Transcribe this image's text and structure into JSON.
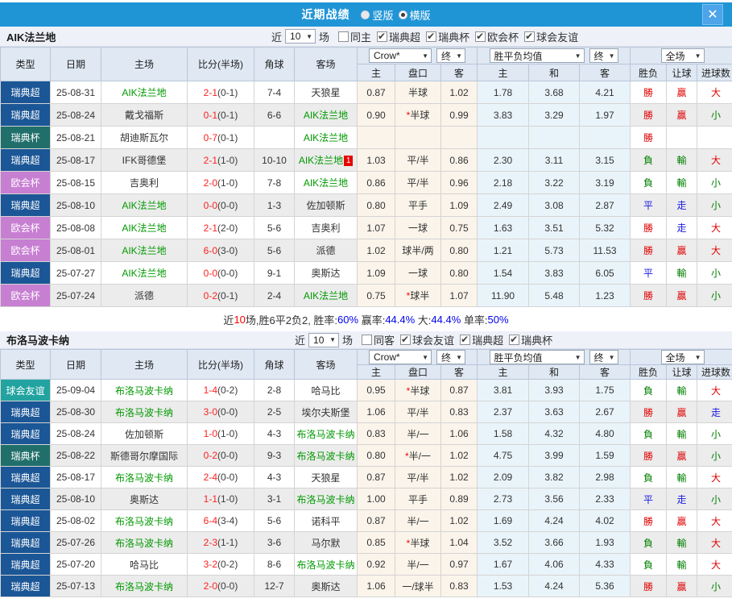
{
  "titlebar": {
    "title": "近期战绩",
    "radios": [
      {
        "label": "竖版",
        "checked": false
      },
      {
        "label": "横版",
        "checked": true
      }
    ],
    "close_icon": "✕"
  },
  "columns": {
    "main": [
      "类型",
      "日期",
      "主场",
      "比分(半场)",
      "角球",
      "客场"
    ],
    "sub": [
      "主",
      "盘口",
      "客",
      "主",
      "和",
      "客",
      "胜负",
      "让球",
      "进球数"
    ],
    "dropdowns": {
      "odds_company": "Crow*",
      "odds_stage": "终",
      "avg_label": "胜平负均值",
      "avg_stage": "终",
      "scope": "全场"
    }
  },
  "colors": {
    "titlebar_bg": "#2095d6",
    "type_badges": {
      "瑞典超": "#1b5696",
      "瑞典杯": "#206f6b",
      "欧会杯": "#c77fd2",
      "球会友谊": "#22a3a0"
    },
    "focus_team": "#009900",
    "score_fulltime": "#ff2020",
    "result_win": "#e00000",
    "result_lose": "#008000",
    "result_draw": "#1a1ae0",
    "summary_value_blue": "#0000ee",
    "summary_value_red": "#ff0000"
  },
  "result_color_map": {
    "勝": "win",
    "贏": "win",
    "大": "win",
    "負": "lose",
    "輸": "lose",
    "小": "lose",
    "平": "draw",
    "走": "draw"
  },
  "tables": [
    {
      "team": "AIK法兰地",
      "filter": {
        "near_label": "近",
        "games": "10",
        "games_suffix": "场",
        "checkboxes": [
          {
            "label": "同主",
            "checked": false
          },
          {
            "label": "瑞典超",
            "checked": true
          },
          {
            "label": "瑞典杯",
            "checked": true
          },
          {
            "label": "欧会杯",
            "checked": true
          },
          {
            "label": "球会友谊",
            "checked": true
          }
        ]
      },
      "rows": [
        {
          "type": "瑞典超",
          "date": "25-08-31",
          "home": "AIK法兰地",
          "hf": true,
          "score": "2-1",
          "half": "(0-1)",
          "corner": "7-4",
          "away": "天狼星",
          "af": false,
          "card": "",
          "star": false,
          "odds": [
            "0.87",
            "半球",
            "1.02"
          ],
          "avg": [
            "1.78",
            "3.68",
            "4.21"
          ],
          "res": [
            "勝",
            "贏",
            "大"
          ]
        },
        {
          "type": "瑞典超",
          "date": "25-08-24",
          "home": "戴戈福斯",
          "hf": false,
          "score": "0-1",
          "half": "(0-1)",
          "corner": "6-6",
          "away": "AIK法兰地",
          "af": true,
          "card": "",
          "star": true,
          "odds": [
            "0.90",
            "半球",
            "0.99"
          ],
          "avg": [
            "3.83",
            "3.29",
            "1.97"
          ],
          "res": [
            "勝",
            "贏",
            "小"
          ]
        },
        {
          "type": "瑞典杯",
          "date": "25-08-21",
          "home": "胡迪斯瓦尔",
          "hf": false,
          "score": "0-7",
          "half": "(0-1)",
          "corner": "",
          "away": "AIK法兰地",
          "af": true,
          "card": "",
          "star": false,
          "odds": [
            "",
            "",
            ""
          ],
          "avg": [
            "",
            "",
            ""
          ],
          "res": [
            "勝",
            "",
            ""
          ]
        },
        {
          "type": "瑞典超",
          "date": "25-08-17",
          "home": "IFK哥德堡",
          "hf": false,
          "score": "2-1",
          "half": "(1-0)",
          "corner": "10-10",
          "away": "AIK法兰地",
          "af": true,
          "card": "1",
          "star": false,
          "odds": [
            "1.03",
            "平/半",
            "0.86"
          ],
          "avg": [
            "2.30",
            "3.11",
            "3.15"
          ],
          "res": [
            "負",
            "輸",
            "大"
          ]
        },
        {
          "type": "欧会杯",
          "date": "25-08-15",
          "home": "吉奥利",
          "hf": false,
          "score": "2-0",
          "half": "(1-0)",
          "corner": "7-8",
          "away": "AIK法兰地",
          "af": true,
          "card": "",
          "star": false,
          "odds": [
            "0.86",
            "平/半",
            "0.96"
          ],
          "avg": [
            "2.18",
            "3.22",
            "3.19"
          ],
          "res": [
            "負",
            "輸",
            "小"
          ]
        },
        {
          "type": "瑞典超",
          "date": "25-08-10",
          "home": "AIK法兰地",
          "hf": true,
          "score": "0-0",
          "half": "(0-0)",
          "corner": "1-3",
          "away": "佐加顿斯",
          "af": false,
          "card": "",
          "star": false,
          "odds": [
            "0.80",
            "平手",
            "1.09"
          ],
          "avg": [
            "2.49",
            "3.08",
            "2.87"
          ],
          "res": [
            "平",
            "走",
            "小"
          ]
        },
        {
          "type": "欧会杯",
          "date": "25-08-08",
          "home": "AIK法兰地",
          "hf": true,
          "score": "2-1",
          "half": "(2-0)",
          "corner": "5-6",
          "away": "吉奥利",
          "af": false,
          "card": "",
          "star": false,
          "odds": [
            "1.07",
            "一球",
            "0.75"
          ],
          "avg": [
            "1.63",
            "3.51",
            "5.32"
          ],
          "res": [
            "勝",
            "走",
            "大"
          ]
        },
        {
          "type": "欧会杯",
          "date": "25-08-01",
          "home": "AIK法兰地",
          "hf": true,
          "score": "6-0",
          "half": "(3-0)",
          "corner": "5-6",
          "away": "派德",
          "af": false,
          "card": "",
          "star": false,
          "odds": [
            "1.02",
            "球半/两",
            "0.80"
          ],
          "avg": [
            "1.21",
            "5.73",
            "11.53"
          ],
          "res": [
            "勝",
            "贏",
            "大"
          ]
        },
        {
          "type": "瑞典超",
          "date": "25-07-27",
          "home": "AIK法兰地",
          "hf": true,
          "score": "0-0",
          "half": "(0-0)",
          "corner": "9-1",
          "away": "奥斯达",
          "af": false,
          "card": "",
          "star": false,
          "odds": [
            "1.09",
            "一球",
            "0.80"
          ],
          "avg": [
            "1.54",
            "3.83",
            "6.05"
          ],
          "res": [
            "平",
            "輸",
            "小"
          ]
        },
        {
          "type": "欧会杯",
          "date": "25-07-24",
          "home": "派德",
          "hf": false,
          "score": "0-2",
          "half": "(0-1)",
          "corner": "2-4",
          "away": "AIK法兰地",
          "af": true,
          "card": "",
          "star": true,
          "odds": [
            "0.75",
            "球半",
            "1.07"
          ],
          "avg": [
            "11.90",
            "5.48",
            "1.23"
          ],
          "res": [
            "勝",
            "贏",
            "小"
          ]
        }
      ],
      "summary": [
        {
          "text": "近",
          "color": "dark"
        },
        {
          "text": "10",
          "color": "red"
        },
        {
          "text": "场,胜6平2负2, 胜率:",
          "color": "dark"
        },
        {
          "text": "60%",
          "color": "blue"
        },
        {
          "text": " 赢率:",
          "color": "dark"
        },
        {
          "text": "44.4%",
          "color": "blue"
        },
        {
          "text": " 大:",
          "color": "dark"
        },
        {
          "text": "44.4%",
          "color": "blue"
        },
        {
          "text": " 单率:",
          "color": "dark"
        },
        {
          "text": "50%",
          "color": "blue"
        }
      ]
    },
    {
      "team": "布洛马波卡纳",
      "filter": {
        "near_label": "近",
        "games": "10",
        "games_suffix": "场",
        "checkboxes": [
          {
            "label": "同客",
            "checked": false
          },
          {
            "label": "球会友谊",
            "checked": true
          },
          {
            "label": "瑞典超",
            "checked": true
          },
          {
            "label": "瑞典杯",
            "checked": true
          }
        ]
      },
      "rows": [
        {
          "type": "球会友谊",
          "date": "25-09-04",
          "home": "布洛马波卡纳",
          "hf": true,
          "score": "1-4",
          "half": "(0-2)",
          "corner": "2-8",
          "away": "哈马比",
          "af": false,
          "card": "",
          "star": true,
          "odds": [
            "0.95",
            "半球",
            "0.87"
          ],
          "avg": [
            "3.81",
            "3.93",
            "1.75"
          ],
          "res": [
            "負",
            "輸",
            "大"
          ]
        },
        {
          "type": "瑞典超",
          "date": "25-08-30",
          "home": "布洛马波卡纳",
          "hf": true,
          "score": "3-0",
          "half": "(0-0)",
          "corner": "2-5",
          "away": "埃尔夫斯堡",
          "af": false,
          "card": "",
          "star": false,
          "odds": [
            "1.06",
            "平/半",
            "0.83"
          ],
          "avg": [
            "2.37",
            "3.63",
            "2.67"
          ],
          "res": [
            "勝",
            "贏",
            "走"
          ]
        },
        {
          "type": "瑞典超",
          "date": "25-08-24",
          "home": "佐加顿斯",
          "hf": false,
          "score": "1-0",
          "half": "(1-0)",
          "corner": "4-3",
          "away": "布洛马波卡纳",
          "af": true,
          "card": "",
          "star": false,
          "odds": [
            "0.83",
            "半/一",
            "1.06"
          ],
          "avg": [
            "1.58",
            "4.32",
            "4.80"
          ],
          "res": [
            "負",
            "輸",
            "小"
          ]
        },
        {
          "type": "瑞典杯",
          "date": "25-08-22",
          "home": "斯德哥尔摩国际",
          "hf": false,
          "score": "0-2",
          "half": "(0-0)",
          "corner": "9-3",
          "away": "布洛马波卡纳",
          "af": true,
          "card": "",
          "star": true,
          "odds": [
            "0.80",
            "半/一",
            "1.02"
          ],
          "avg": [
            "4.75",
            "3.99",
            "1.59"
          ],
          "res": [
            "勝",
            "贏",
            "小"
          ]
        },
        {
          "type": "瑞典超",
          "date": "25-08-17",
          "home": "布洛马波卡纳",
          "hf": true,
          "score": "2-4",
          "half": "(0-0)",
          "corner": "4-3",
          "away": "天狼星",
          "af": false,
          "card": "",
          "star": false,
          "odds": [
            "0.87",
            "平/半",
            "1.02"
          ],
          "avg": [
            "2.09",
            "3.82",
            "2.98"
          ],
          "res": [
            "負",
            "輸",
            "大"
          ]
        },
        {
          "type": "瑞典超",
          "date": "25-08-10",
          "home": "奥斯达",
          "hf": false,
          "score": "1-1",
          "half": "(1-0)",
          "corner": "3-1",
          "away": "布洛马波卡纳",
          "af": true,
          "card": "",
          "star": false,
          "odds": [
            "1.00",
            "平手",
            "0.89"
          ],
          "avg": [
            "2.73",
            "3.56",
            "2.33"
          ],
          "res": [
            "平",
            "走",
            "小"
          ]
        },
        {
          "type": "瑞典超",
          "date": "25-08-02",
          "home": "布洛马波卡纳",
          "hf": true,
          "score": "6-4",
          "half": "(3-4)",
          "corner": "5-6",
          "away": "诺科平",
          "af": false,
          "card": "",
          "star": false,
          "odds": [
            "0.87",
            "半/一",
            "1.02"
          ],
          "avg": [
            "1.69",
            "4.24",
            "4.02"
          ],
          "res": [
            "勝",
            "贏",
            "大"
          ]
        },
        {
          "type": "瑞典超",
          "date": "25-07-26",
          "home": "布洛马波卡纳",
          "hf": true,
          "score": "2-3",
          "half": "(1-1)",
          "corner": "3-6",
          "away": "马尔默",
          "af": false,
          "card": "",
          "star": true,
          "odds": [
            "0.85",
            "半球",
            "1.04"
          ],
          "avg": [
            "3.52",
            "3.66",
            "1.93"
          ],
          "res": [
            "負",
            "輸",
            "大"
          ]
        },
        {
          "type": "瑞典超",
          "date": "25-07-20",
          "home": "哈马比",
          "hf": false,
          "score": "3-2",
          "half": "(0-2)",
          "corner": "8-6",
          "away": "布洛马波卡纳",
          "af": true,
          "card": "",
          "star": false,
          "odds": [
            "0.92",
            "半/一",
            "0.97"
          ],
          "avg": [
            "1.67",
            "4.06",
            "4.33"
          ],
          "res": [
            "負",
            "輸",
            "大"
          ]
        },
        {
          "type": "瑞典超",
          "date": "25-07-13",
          "home": "布洛马波卡纳",
          "hf": true,
          "score": "2-0",
          "half": "(0-0)",
          "corner": "12-7",
          "away": "奥斯达",
          "af": false,
          "card": "",
          "star": false,
          "odds": [
            "1.06",
            "一/球半",
            "0.83"
          ],
          "avg": [
            "1.53",
            "4.24",
            "5.36"
          ],
          "res": [
            "勝",
            "贏",
            "小"
          ]
        }
      ],
      "summary": null
    }
  ]
}
